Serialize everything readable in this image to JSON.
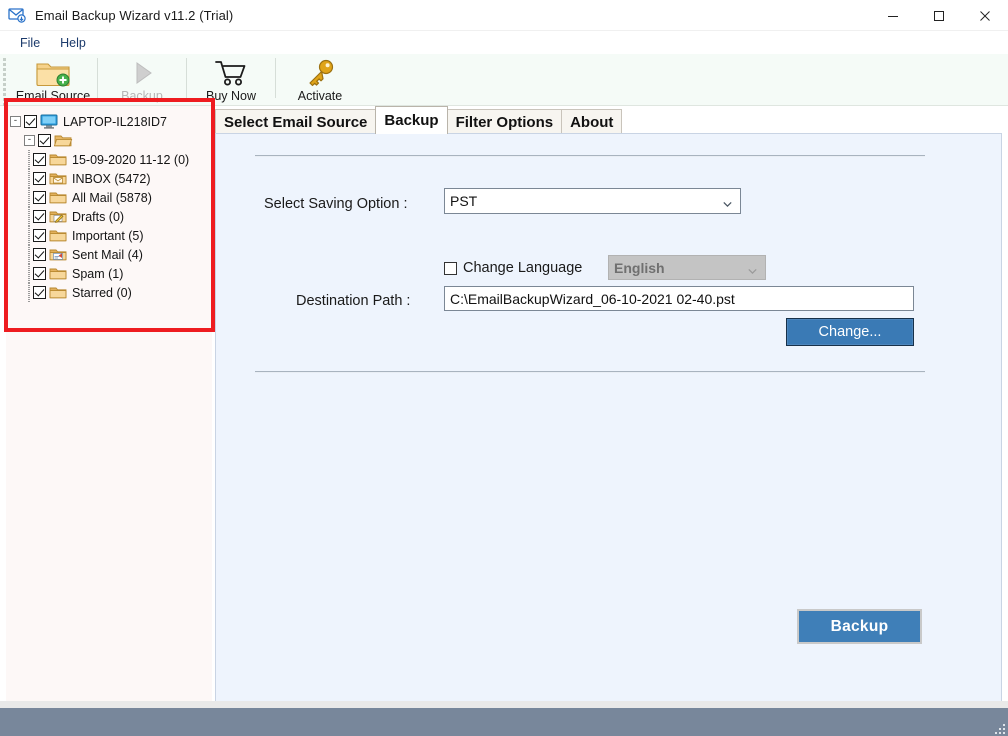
{
  "window": {
    "title": "Email Backup Wizard v11.2 (Trial)",
    "app_icon": "envelope-badge-icon",
    "controls": {
      "minimize": "minimize-icon",
      "maximize": "maximize-icon",
      "close": "close-icon"
    }
  },
  "menubar": {
    "items": [
      {
        "label": "File"
      },
      {
        "label": "Help"
      }
    ]
  },
  "toolbar": {
    "buttons": [
      {
        "label": "Email Source",
        "icon": "folder-add-icon",
        "enabled": true
      },
      {
        "label": "Backup",
        "icon": "play-triangle-icon",
        "enabled": false
      },
      {
        "label": "Buy Now",
        "icon": "shopping-cart-icon",
        "enabled": true
      },
      {
        "label": "Activate",
        "icon": "key-icon",
        "enabled": true
      }
    ]
  },
  "tree": {
    "root": {
      "label": "LAPTOP-IL218ID7",
      "icon": "computer-monitor-icon",
      "checked": true,
      "expander": "-"
    },
    "account": {
      "label": "",
      "icon": "open-folder-icon",
      "checked": true,
      "expander": "-"
    },
    "folders": [
      {
        "label": "15-09-2020 11-12 (0)",
        "icon": "folder-icon",
        "checked": true
      },
      {
        "label": "INBOX (5472)",
        "icon": "folder-inbox-icon",
        "checked": true
      },
      {
        "label": "All Mail (5878)",
        "icon": "folder-icon",
        "checked": true
      },
      {
        "label": "Drafts (0)",
        "icon": "folder-drafts-icon",
        "checked": true
      },
      {
        "label": "Important (5)",
        "icon": "folder-icon",
        "checked": true
      },
      {
        "label": "Sent Mail (4)",
        "icon": "folder-sent-icon",
        "checked": true
      },
      {
        "label": "Spam (1)",
        "icon": "folder-icon",
        "checked": true
      },
      {
        "label": "Starred (0)",
        "icon": "folder-icon",
        "checked": true
      }
    ]
  },
  "tabs": [
    {
      "label": "Select Email Source",
      "active": false
    },
    {
      "label": "Backup",
      "active": true
    },
    {
      "label": "Filter Options",
      "active": false
    },
    {
      "label": "About",
      "active": false
    }
  ],
  "form": {
    "saving_option_label": "Select Saving Option :",
    "saving_option_value": "PST",
    "saving_option_options": [
      "PST"
    ],
    "change_language_label": "Change Language",
    "change_language_checked": false,
    "language_value": "English",
    "language_enabled": false,
    "destination_path_label": "Destination Path :",
    "destination_path_value": "C:\\EmailBackupWizard_06-10-2021 02-40.pst",
    "change_button_label": "Change...",
    "backup_button_label": "Backup"
  },
  "colors": {
    "accent_blue": "#3f7fb8",
    "panel_blue": "#eef4fd",
    "tree_panel": "#fdf8f7",
    "toolbar_bg": "#f5fbf7",
    "statusbar": "#78879b",
    "highlight_red": "#ee1c20",
    "menu_text": "#1b3a6b"
  }
}
